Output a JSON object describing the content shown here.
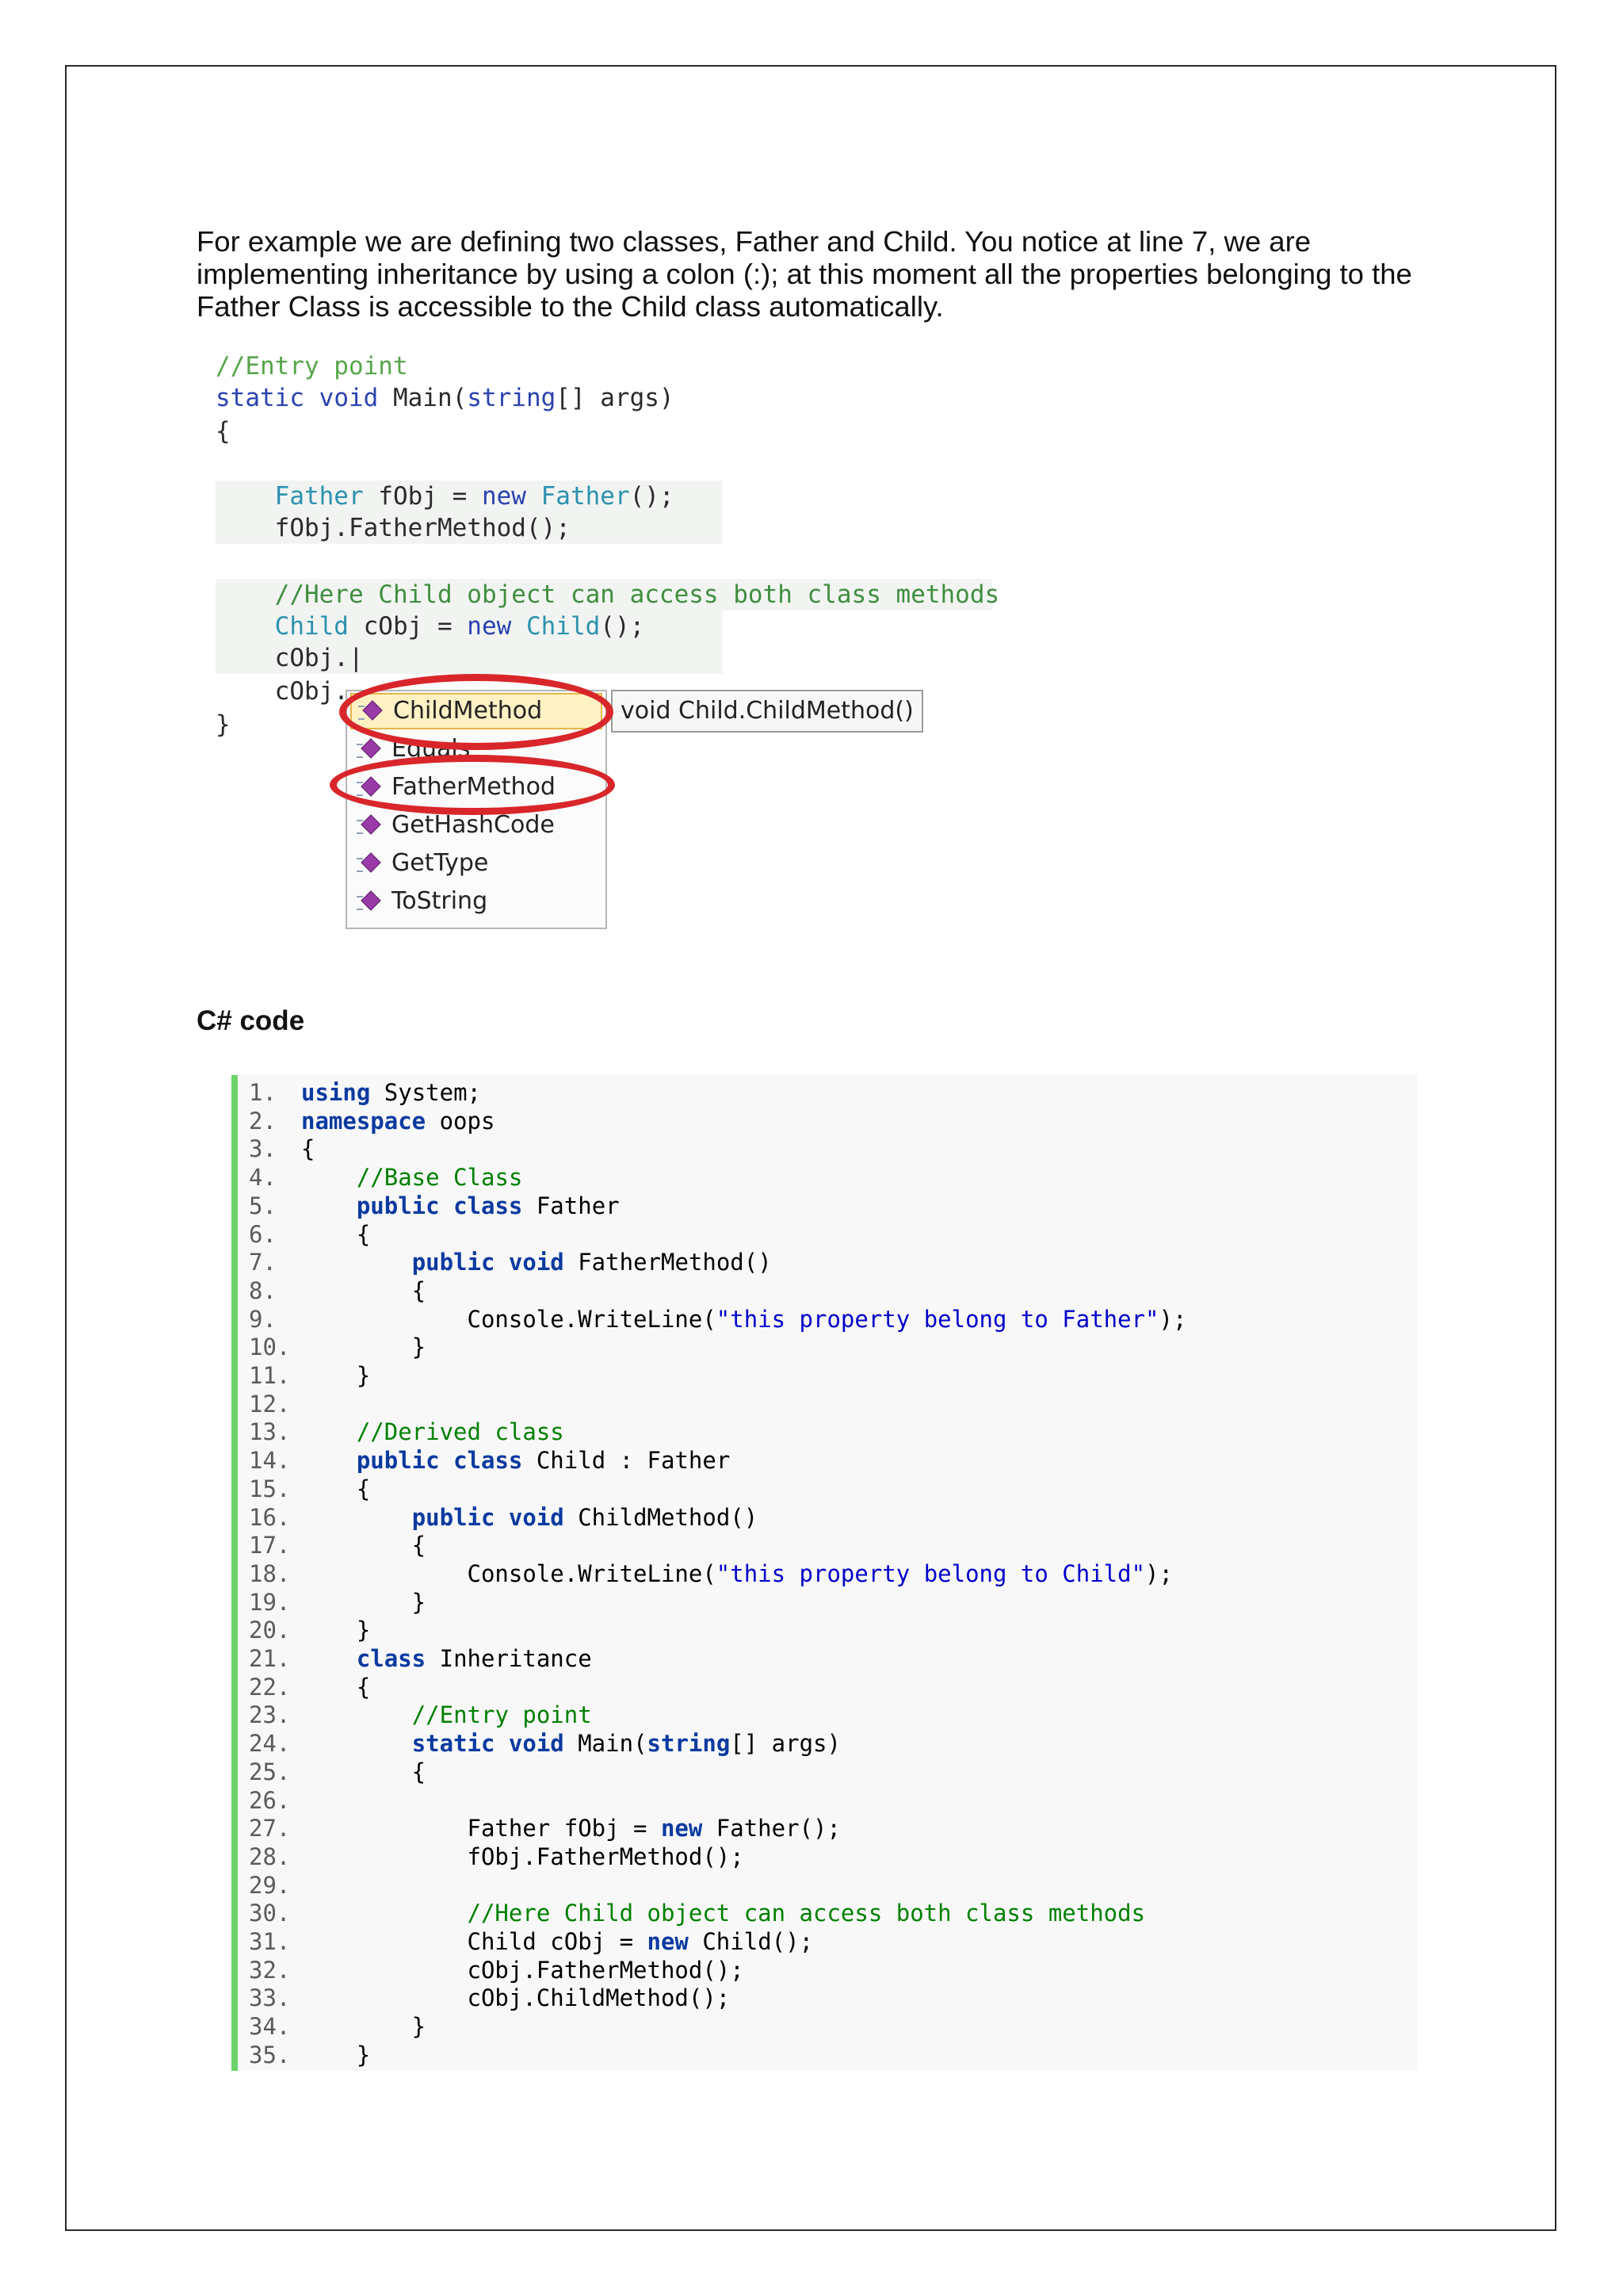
{
  "intro_text": "For example we are defining two classes, Father and Child. You notice at line 7, we are implementing inheritance by using a colon (:); at this moment all the properties belonging to the Father Class is accessible to the Child class automatically.",
  "ide_screenshot": {
    "lines": [
      "//Entry point",
      "static void Main(string[] args)",
      "{",
      "",
      "    Father fObj = new Father();",
      "    fObj.FatherMethod();",
      "",
      "    //Here Child object can access both class methods",
      "    Child cObj = new Child();",
      "    cObj.|",
      "    cObj.",
      "}"
    ],
    "completion_items": [
      "ChildMethod",
      "Equals",
      "FatherMethod",
      "GetHashCode",
      "GetType",
      "ToString"
    ],
    "selected_item": "ChildMethod",
    "tooltip": "void Child.ChildMethod()",
    "highlight_color": "#d8262a"
  },
  "heading": "C# code",
  "code_listing": [
    {
      "n": "1.",
      "text": "using System;"
    },
    {
      "n": "2.",
      "text": "namespace oops"
    },
    {
      "n": "3.",
      "text": "{"
    },
    {
      "n": "4.",
      "text": "    //Base Class"
    },
    {
      "n": "5.",
      "text": "    public class Father"
    },
    {
      "n": "6.",
      "text": "    {"
    },
    {
      "n": "7.",
      "text": "        public void FatherMethod()"
    },
    {
      "n": "8.",
      "text": "        {"
    },
    {
      "n": "9.",
      "text": "            Console.WriteLine(\"this property belong to Father\");"
    },
    {
      "n": "10.",
      "text": "        }"
    },
    {
      "n": "11.",
      "text": "    }"
    },
    {
      "n": "12.",
      "text": ""
    },
    {
      "n": "13.",
      "text": "    //Derived class"
    },
    {
      "n": "14.",
      "text": "    public class Child : Father"
    },
    {
      "n": "15.",
      "text": "    {"
    },
    {
      "n": "16.",
      "text": "        public void ChildMethod()"
    },
    {
      "n": "17.",
      "text": "        {"
    },
    {
      "n": "18.",
      "text": "            Console.WriteLine(\"this property belong to Child\");"
    },
    {
      "n": "19.",
      "text": "        }"
    },
    {
      "n": "20.",
      "text": "    }"
    },
    {
      "n": "21.",
      "text": "    class Inheritance"
    },
    {
      "n": "22.",
      "text": "    {"
    },
    {
      "n": "23.",
      "text": "        //Entry point"
    },
    {
      "n": "24.",
      "text": "        static void Main(string[] args)"
    },
    {
      "n": "25.",
      "text": "        {"
    },
    {
      "n": "26.",
      "text": ""
    },
    {
      "n": "27.",
      "text": "            Father fObj = new Father();"
    },
    {
      "n": "28.",
      "text": "            fObj.FatherMethod();"
    },
    {
      "n": "29.",
      "text": ""
    },
    {
      "n": "30.",
      "text": "            //Here Child object can access both class methods"
    },
    {
      "n": "31.",
      "text": "            Child cObj = new Child();"
    },
    {
      "n": "32.",
      "text": "            cObj.FatherMethod();"
    },
    {
      "n": "33.",
      "text": "            cObj.ChildMethod();"
    },
    {
      "n": "34.",
      "text": "        }"
    },
    {
      "n": "35.",
      "text": "    }"
    }
  ],
  "colors": {
    "code_border": "#6bd46b",
    "keyword": "#0b3aa0",
    "comment": "#008000",
    "string": "#0000cc"
  }
}
